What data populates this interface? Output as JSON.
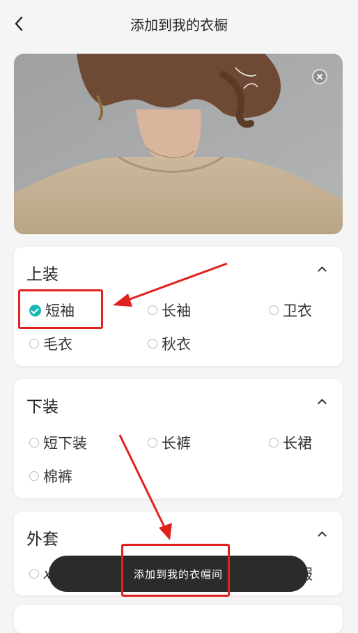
{
  "header": {
    "title": "添加到我的衣橱"
  },
  "sections": [
    {
      "title": "上装",
      "options": [
        "短袖",
        "长袖",
        "卫衣",
        "毛衣",
        "秋衣"
      ],
      "checked": "短袖"
    },
    {
      "title": "下装",
      "options": [
        "短下装",
        "长裤",
        "长裙",
        "棉裤"
      ]
    },
    {
      "title": "外套",
      "options_partial": [
        "𝑥",
        "服"
      ]
    }
  ],
  "toast": {
    "message": "添加到我的衣帽间"
  },
  "colors": {
    "accent": "#19b7b5",
    "annotation": "#e0211e"
  }
}
